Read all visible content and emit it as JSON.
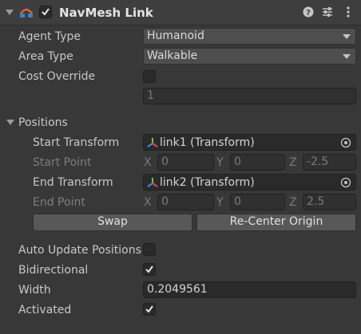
{
  "header": {
    "title": "NavMesh Link",
    "enabled": true,
    "component_icon": "navmesh-link-icon",
    "help_icon": "help-icon",
    "presets_icon": "presets-icon",
    "menu_icon": "kebab-menu-icon"
  },
  "fields": {
    "agent_type": {
      "label": "Agent Type",
      "value": "Humanoid"
    },
    "area_type": {
      "label": "Area Type",
      "value": "Walkable"
    },
    "cost_override": {
      "label": "Cost Override",
      "checked": false,
      "value": "1"
    }
  },
  "positions": {
    "label": "Positions",
    "start_transform": {
      "label": "Start Transform",
      "value": "link1 (Transform)"
    },
    "start_point": {
      "label": "Start Point",
      "x": "0",
      "y": "0",
      "z": "-2.5"
    },
    "end_transform": {
      "label": "End Transform",
      "value": "link2 (Transform)"
    },
    "end_point": {
      "label": "End Point",
      "x": "0",
      "y": "0",
      "z": "2.5"
    },
    "swap_label": "Swap",
    "recenter_label": "Re-Center Origin",
    "axis_x": "X",
    "axis_y": "Y",
    "axis_z": "Z"
  },
  "auto_update": {
    "label": "Auto Update Positions",
    "checked": false
  },
  "bidirectional": {
    "label": "Bidirectional",
    "checked": true
  },
  "width": {
    "label": "Width",
    "value": "0.2049561"
  },
  "activated": {
    "label": "Activated",
    "checked": true
  },
  "colors": {
    "background": "#383838",
    "field": "#2a2a2a",
    "button": "#585858",
    "text": "#d2d2d2",
    "dim_text": "#7a7a7a"
  }
}
